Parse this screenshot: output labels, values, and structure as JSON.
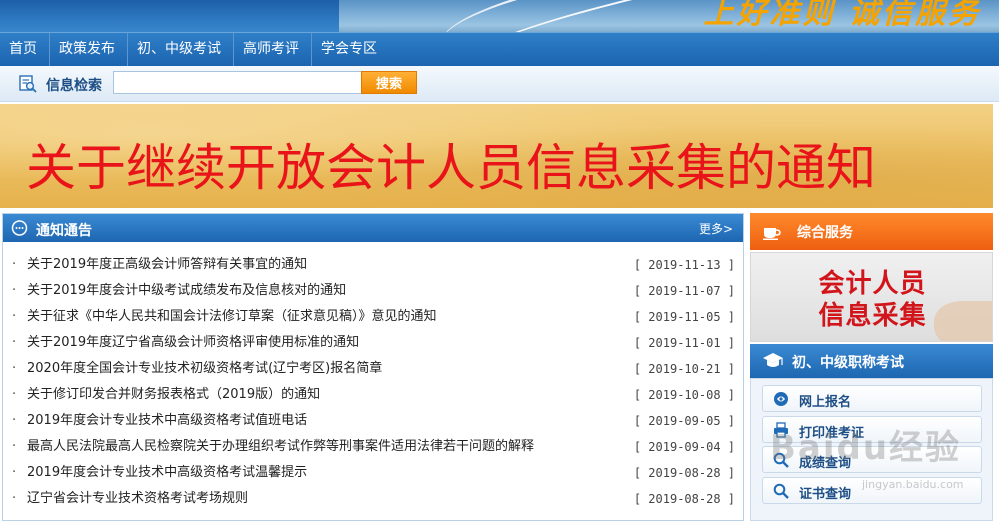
{
  "header": {
    "slogan": "上好准则 诚信服务"
  },
  "nav": {
    "items": [
      "首页",
      "政策发布",
      "初、中级考试",
      "高师考评",
      "学会专区"
    ]
  },
  "search": {
    "label": "信息检索",
    "value": "",
    "placeholder": "",
    "button": "搜索"
  },
  "banner": {
    "text": "关于继续开放会计人员信息采集的通知"
  },
  "notices": {
    "title": "通知通告",
    "more": "更多>",
    "items": [
      {
        "title": "关于2019年度正高级会计师答辩有关事宜的通知",
        "date": "[ 2019-11-13 ]"
      },
      {
        "title": "关于2019年度会计中级考试成绩发布及信息核对的通知",
        "date": "[ 2019-11-07 ]"
      },
      {
        "title": "关于征求《中华人民共和国会计法修订草案（征求意见稿）》意见的通知",
        "date": "[ 2019-11-05 ]"
      },
      {
        "title": "关于2019年度辽宁省高级会计师资格评审使用标准的通知",
        "date": "[ 2019-11-01 ]"
      },
      {
        "title": "2020年度全国会计专业技术初级资格考试(辽宁考区)报名简章",
        "date": "[ 2019-10-21 ]"
      },
      {
        "title": "关于修订印发合并财务报表格式（2019版）的通知",
        "date": "[ 2019-10-08 ]"
      },
      {
        "title": "2019年度会计专业技术中高级资格考试值班电话",
        "date": "[ 2019-09-05 ]"
      },
      {
        "title": "最高人民法院最高人民检察院关于办理组织考试作弊等刑事案件适用法律若干问题的解释",
        "date": "[ 2019-09-04 ]"
      },
      {
        "title": "2019年度会计专业技术中高级资格考试温馨提示",
        "date": "[ 2019-08-28 ]"
      },
      {
        "title": "辽宁省会计专业技术资格考试考场规则",
        "date": "[ 2019-08-28 ]"
      }
    ]
  },
  "sidebar": {
    "service_title": "综合服务",
    "collect_line1": "会计人员",
    "collect_line2": "信息采集",
    "exam_title": "初、中级职称考试",
    "exam_buttons": [
      "网上报名",
      "打印准考证",
      "成绩查询",
      "证书查询"
    ]
  },
  "watermark": {
    "text": "Baidu经验",
    "sub": "jingyan.baidu.com"
  },
  "colors": {
    "nav_blue": "#1c64b0",
    "accent_orange": "#f08a00",
    "notice_red": "#e8141a"
  }
}
